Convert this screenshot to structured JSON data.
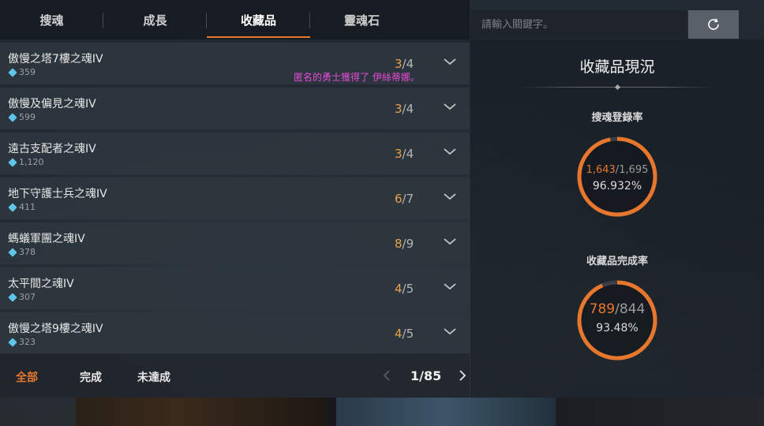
{
  "tabs": [
    {
      "label": "搜魂",
      "active": false
    },
    {
      "label": "成長",
      "active": false
    },
    {
      "label": "收藏品",
      "active": true
    },
    {
      "label": "靈魂石",
      "active": false
    }
  ],
  "search": {
    "placeholder": "請輸入關鍵字。"
  },
  "items": [
    {
      "name": "傲慢之塔7樓之魂IV",
      "points": "359",
      "have": "3",
      "total": "4"
    },
    {
      "name": "傲慢及偏見之魂IV",
      "points": "599",
      "have": "3",
      "total": "4"
    },
    {
      "name": "遠古支配者之魂IV",
      "points": "1,120",
      "have": "3",
      "total": "4"
    },
    {
      "name": "地下守護士兵之魂IV",
      "points": "411",
      "have": "6",
      "total": "7"
    },
    {
      "name": "螞蟻軍團之魂IV",
      "points": "378",
      "have": "8",
      "total": "9"
    },
    {
      "name": "太平間之魂IV",
      "points": "307",
      "have": "4",
      "total": "5"
    },
    {
      "name": "傲慢之塔9樓之魂IV",
      "points": "323",
      "have": "4",
      "total": "5"
    }
  ],
  "notification": {
    "prefix": "匿名的勇士獲得了 ",
    "item": "伊絲蒂娜",
    "suffix": "。"
  },
  "filters": [
    {
      "label": "全部",
      "active": true
    },
    {
      "label": "完成",
      "active": false
    },
    {
      "label": "未達成",
      "active": false
    }
  ],
  "pager": {
    "text": "1/85"
  },
  "panel": {
    "title": "收藏品現況",
    "soul_rate": {
      "label": "搜魂登錄率",
      "current": "1,643",
      "total": "1,695",
      "percent": "96.932%",
      "fraction": 0.96932
    },
    "collection_rate": {
      "label": "收藏品完成率",
      "current": "789",
      "total": "844",
      "percent": "93.48%",
      "fraction": 0.9348
    }
  },
  "colors": {
    "accent": "#e8772e",
    "count_have": "#e8a24a",
    "notify": "#e64bd8",
    "gem": "#5fc5e8"
  },
  "icons": {
    "refresh": "refresh-icon",
    "chevron": "chevron-down-icon",
    "gem": "soul-gem-icon"
  }
}
